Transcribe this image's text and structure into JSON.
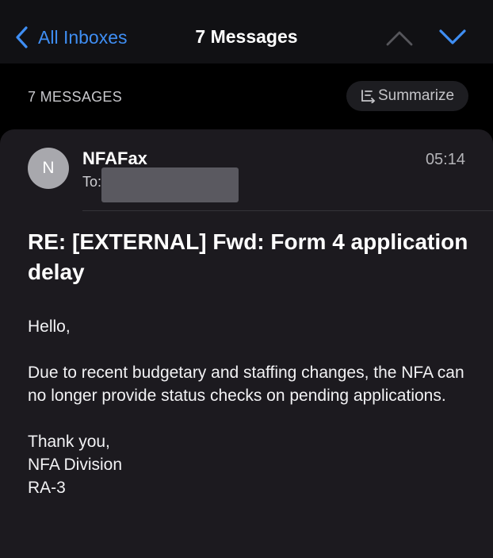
{
  "nav": {
    "back_label": "All Inboxes",
    "title": "7 Messages",
    "up_icon": "chevron-up-icon",
    "down_icon": "chevron-down-icon"
  },
  "thread": {
    "count_label": "7 MESSAGES",
    "summarize_label": "Summarize"
  },
  "message": {
    "avatar_initial": "N",
    "sender": "NFAFax",
    "to_label": "To:",
    "time": "05:14",
    "subject": "RE: [EXTERNAL] Fwd: Form 4 application delay",
    "greeting": "Hello,",
    "paragraph": "Due to recent budgetary and staffing changes, the NFA can no longer provide status checks on pending applications.",
    "signoff": "Thank you,",
    "signature_line1": "NFA Division",
    "signature_line2": "RA-3"
  },
  "colors": {
    "accent": "#3f8ef3",
    "background": "#000000",
    "card": "#1c1a1f",
    "avatar": "#a8a8ad"
  }
}
